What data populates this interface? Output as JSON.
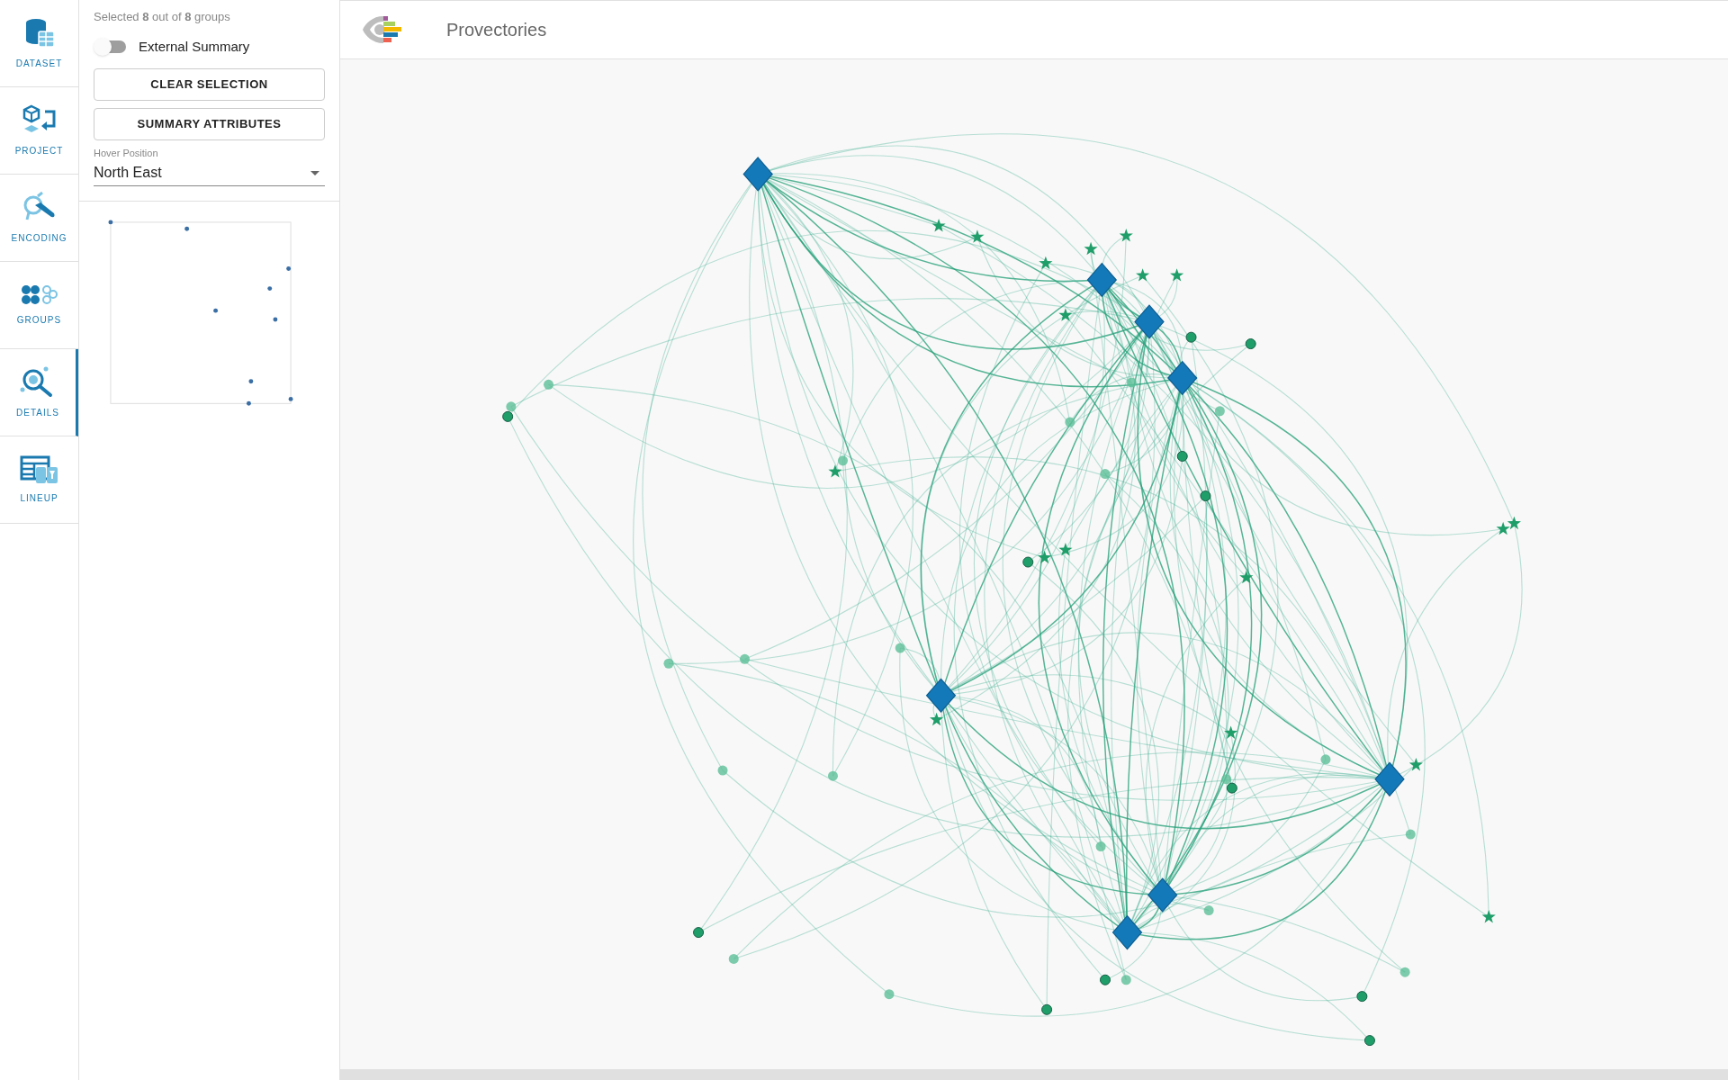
{
  "sidebar": {
    "items": [
      {
        "kind": "dataset",
        "label": "DATASET",
        "selected": false
      },
      {
        "kind": "project",
        "label": "PROJECT",
        "selected": false
      },
      {
        "kind": "encoding",
        "label": "ENCODING",
        "selected": false
      },
      {
        "kind": "groups",
        "label": "GROUPS",
        "selected": false
      },
      {
        "kind": "details",
        "label": "DETAILS",
        "selected": true
      },
      {
        "kind": "lineup",
        "label": "LINEUP",
        "selected": false
      }
    ]
  },
  "panel": {
    "selection_summary": "Selected **8** out of **8** groups",
    "external_summary": {
      "label": "External Summary",
      "on": false
    },
    "buttons": [
      "CLEAR SELECTION",
      "SUMMARY ATTRIBUTES"
    ],
    "hover_position": {
      "label": "Hover Position",
      "value": "North East"
    }
  },
  "header": {
    "title": "Provectories"
  }
}
